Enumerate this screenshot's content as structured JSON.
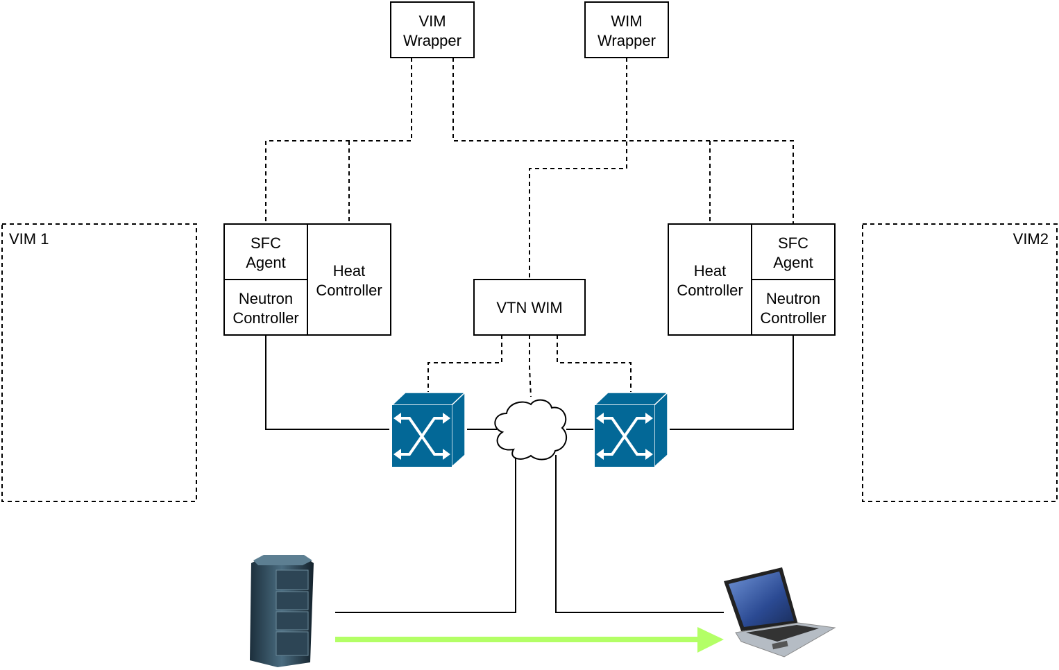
{
  "nodes": {
    "vim_wrapper": [
      "VIM",
      "Wrapper"
    ],
    "wim_wrapper": [
      "WIM",
      "Wrapper"
    ],
    "vim1": "VIM 1",
    "vim2": "VIM2",
    "left_sfc_agent": [
      "SFC",
      "Agent"
    ],
    "left_neutron": [
      "Neutron",
      "Controller"
    ],
    "left_heat": [
      "Heat",
      "Controller"
    ],
    "right_sfc_agent": [
      "SFC",
      "Agent"
    ],
    "right_neutron": [
      "Neutron",
      "Controller"
    ],
    "right_heat": [
      "Heat",
      "Controller"
    ],
    "vtn_wim": "VTN WIM"
  },
  "icons": [
    "switch-icon",
    "switch-icon",
    "cloud-icon",
    "server-rack-icon",
    "laptop-icon"
  ],
  "colors": {
    "switch": "#036897",
    "flow_arrow": "#b3ff66"
  }
}
